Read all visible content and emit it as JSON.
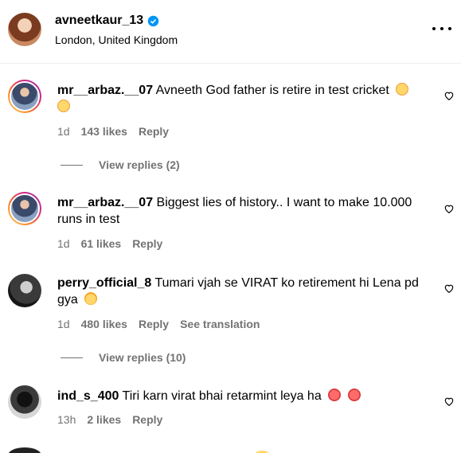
{
  "header": {
    "username": "avneetkaur_13",
    "location": "London, United Kingdom"
  },
  "comments": [
    {
      "user": "mr__arbaz.__07",
      "text": "Avneeth God father is retire in test cricket",
      "time": "1d",
      "likes": "143 likes",
      "reply": "Reply",
      "view_replies": "View replies (2)"
    },
    {
      "user": "mr__arbaz.__07",
      "text": "Biggest lies of history.. I want to make 10.000 runs in test",
      "time": "1d",
      "likes": "61 likes",
      "reply": "Reply"
    },
    {
      "user": "perry_official_8",
      "text": "Tumari vjah se VIRAT ko retirement hi Lena pd gya",
      "time": "1d",
      "likes": "480 likes",
      "reply": "Reply",
      "see_translation": "See translation",
      "view_replies": "View replies (10)"
    },
    {
      "user": "ind_s_400",
      "text": "Tiri karn virat bhai retarmint leya ha",
      "time": "13h",
      "likes": "2 likes",
      "reply": "Reply"
    }
  ]
}
